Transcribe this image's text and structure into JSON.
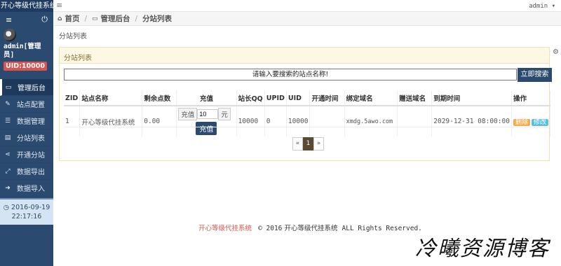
{
  "app": {
    "title": "开心等级代挂系统"
  },
  "sidebar": {
    "user_name": "admin[管理员]",
    "uid_badge": "UID:10000",
    "items": [
      {
        "label": "管理后台",
        "icon": "monitor-icon",
        "active": true
      },
      {
        "label": "站点配置",
        "icon": "edit-icon",
        "active": false
      },
      {
        "label": "数据管理",
        "icon": "list-icon",
        "active": false
      },
      {
        "label": "分站列表",
        "icon": "table-icon",
        "active": false
      },
      {
        "label": "开通分站",
        "icon": "share-icon",
        "active": false
      },
      {
        "label": "数据导出",
        "icon": "expand-icon",
        "active": false
      },
      {
        "label": "数据导入",
        "icon": "sign-in-icon",
        "active": false
      }
    ],
    "date": "2016-09-19",
    "time": "22:17:16"
  },
  "topbar": {
    "user": "admin"
  },
  "breadcrumb": {
    "home": "首页",
    "admin": "管理后台",
    "current": "分站列表"
  },
  "page_title": "分站列表",
  "panel": {
    "heading": "分站列表",
    "search_placeholder": "请输入要搜索的站点名称!",
    "search_button": "立即搜索"
  },
  "table": {
    "headers": [
      "ZID",
      "站点名称",
      "剩余点数",
      "充值",
      "站长QQ",
      "UPID",
      "UID",
      "开通时间",
      "绑定域名",
      "赠送域名",
      "到期时间",
      "操作"
    ],
    "rows": [
      {
        "zid": "1",
        "name": "开心等级代挂系统",
        "points": "0.00",
        "recharge_label": "充值",
        "recharge_value": "10",
        "recharge_unit": "元",
        "recharge_button": "充值",
        "qq": "10000",
        "upid": "0",
        "uid": "10000",
        "open_time": "",
        "domain": "xmdg.5awo.com",
        "gift_domain": "",
        "expire": "2029-12-31 08:00:00",
        "delete_label": "删除",
        "edit_label": "修改"
      }
    ]
  },
  "pagination": {
    "prev": "«",
    "current": "1",
    "next": "»"
  },
  "footer": {
    "brand": "开心等级代挂系统",
    "copyright": "© 2016",
    "name": "开心等级代挂系统",
    "rights": "ALL Rights Reserved."
  },
  "colors": {
    "sidebar": "#2b4a6f",
    "accent_red": "#d9534f",
    "panel_warning": "#fcf8e3"
  }
}
